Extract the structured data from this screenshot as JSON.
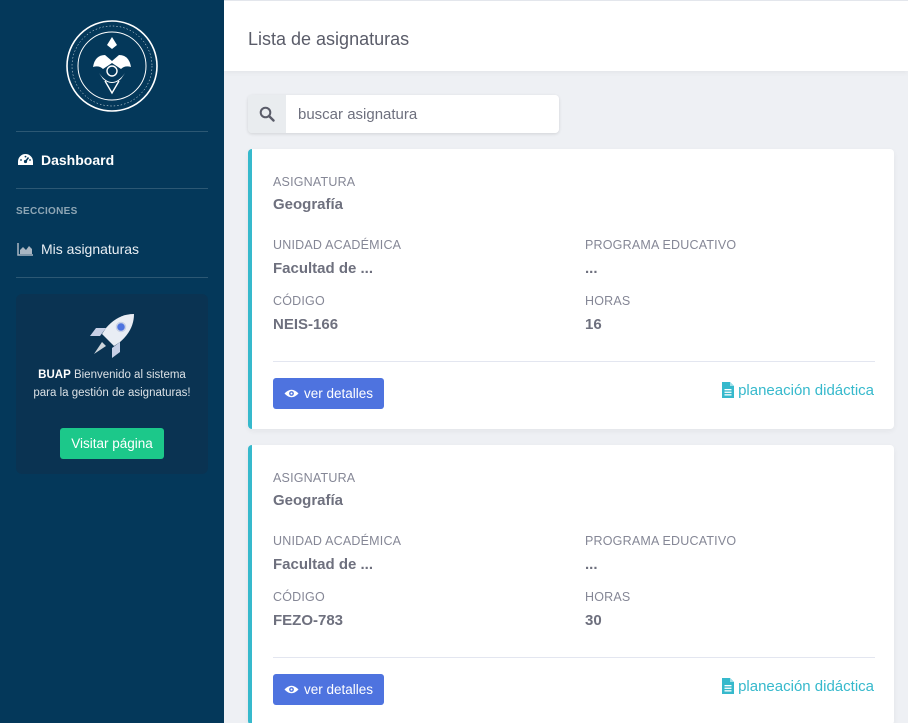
{
  "sidebar": {
    "logo_icon": "university-seal-icon",
    "dashboard_label": "Dashboard",
    "section_label": "SECCIONES",
    "mis_asignaturas_label": "Mis asignaturas",
    "promo": {
      "brand": "BUAP",
      "text": " Bienvenido al sistema para la gestión de asignaturas!",
      "button_label": "Visitar página"
    }
  },
  "header": {
    "title": "Lista de asignaturas"
  },
  "search": {
    "placeholder": "buscar asignatura",
    "value": ""
  },
  "labels": {
    "asignatura": "ASIGNATURA",
    "unidad": "UNIDAD ACADÉMICA",
    "programa": "PROGRAMA EDUCATIVO",
    "codigo": "CÓDIGO",
    "horas": "HORAS",
    "details_button": "ver detalles",
    "planeacion_link": "planeación didáctica"
  },
  "cards": [
    {
      "asignatura": "Geografía",
      "unidad": "Facultad de ...",
      "programa": "...",
      "codigo": "NEIS-166",
      "horas": "16"
    },
    {
      "asignatura": "Geografía",
      "unidad": "Facultad de ...",
      "programa": "...",
      "codigo": "FEZO-783",
      "horas": "30"
    }
  ],
  "colors": {
    "sidebar": "#04385a",
    "accent": "#36b9cc",
    "primary": "#4e73df",
    "success": "#1cc88a"
  }
}
